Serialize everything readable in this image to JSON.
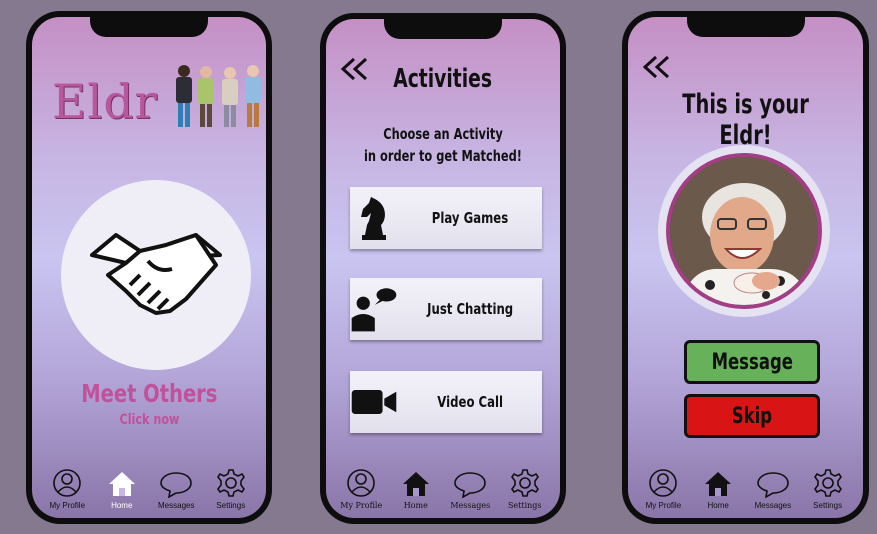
{
  "screen1": {
    "logo": "Eldr",
    "meet_title": "Meet Others",
    "meet_subtitle": "Click now"
  },
  "screen2": {
    "back_icon": "double-chevron-left-icon",
    "title": "Activities",
    "subtitle_line1": "Choose an Activity",
    "subtitle_line2": "in order to get Matched!",
    "activities": [
      {
        "label": "Play Games",
        "icon": "chess-knight-icon"
      },
      {
        "label": "Just Chatting",
        "icon": "person-speech-icon"
      },
      {
        "label": "Video Call",
        "icon": "video-camera-icon"
      }
    ]
  },
  "screen3": {
    "back_icon": "double-chevron-left-icon",
    "title": "This is your Eldr!",
    "message_label": "Message",
    "skip_label": "Skip"
  },
  "nav": {
    "profile": "My Profile",
    "home": "Home",
    "messages": "Messages",
    "settings": "Settings"
  },
  "colors": {
    "brand_pink": "#c2519c",
    "message_green": "#67b15a",
    "skip_red": "#d81414",
    "background": "#85798f"
  }
}
